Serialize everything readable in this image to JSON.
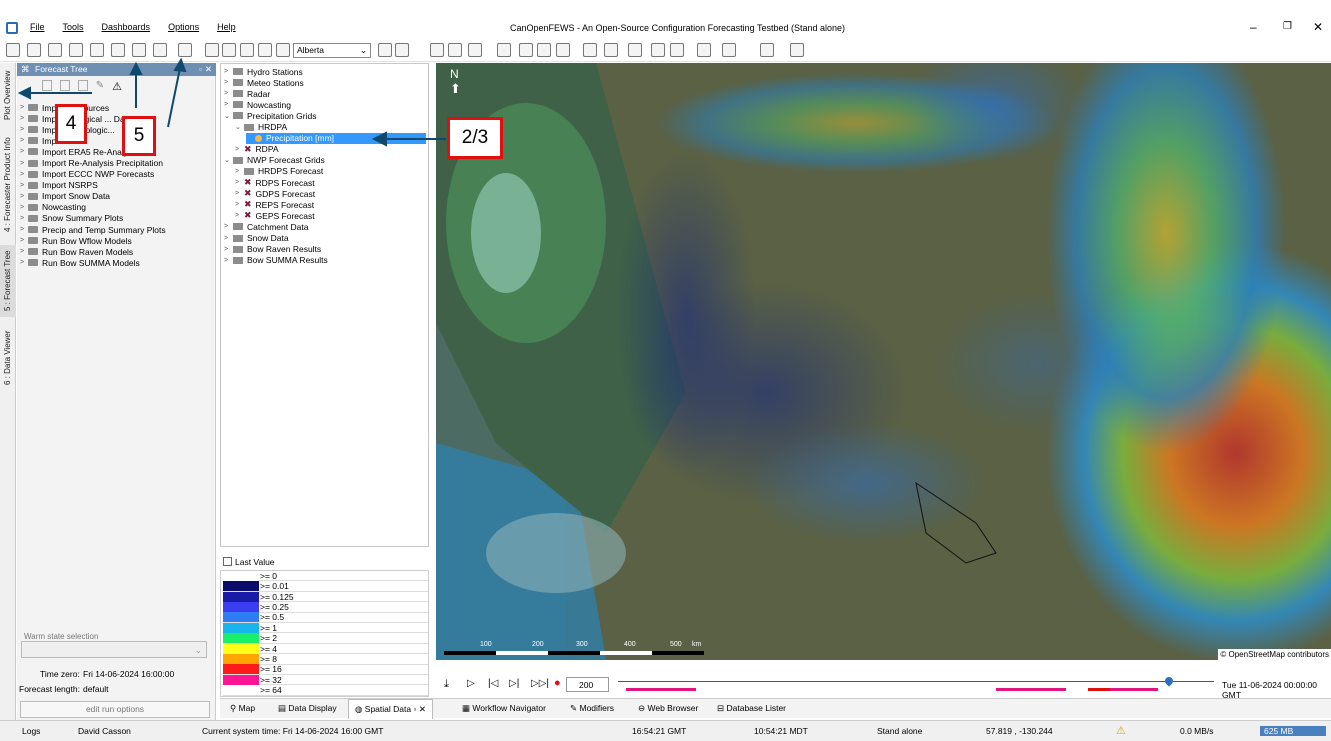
{
  "window": {
    "title": "CanOpenFEWS - An Open-Source Configuration Forecasting Testbed  (Stand alone)"
  },
  "menu": {
    "items": [
      "File",
      "Tools",
      "Dashboards",
      "Options",
      "Help"
    ]
  },
  "toolbar": {
    "region_select": "Alberta"
  },
  "side_tabs": [
    "Plot Overview",
    "4 : Forecaster Product Info",
    "5 : Forecast Tree",
    "6 : Data Viewer"
  ],
  "forecast_tree": {
    "title": "Forecast Tree",
    "items": [
      "Import ... Sources",
      "Import ... logical ... Data Mart",
      "Import ... orologic...",
      "Import ...",
      "Import ERA5 Re-Analy...",
      "Import Re-Analysis Precipitation",
      "Import ECCC NWP Forecasts",
      "Import NSRPS",
      "Import Snow Data",
      "Nowcasting",
      "Snow Summary Plots",
      "Precip and Temp Summary Plots",
      "Run Bow Wflow Models",
      "Run Bow Raven Models",
      "Run Bow SUMMA Models"
    ]
  },
  "left_bottom": {
    "warm_state_label": "Warm state selection",
    "time_zero_label": "Time zero:",
    "time_zero": "Fri 14-06-2024 16:00:00",
    "forecast_length_label": "Forecast length:",
    "forecast_length": "default",
    "edit_run_options": "edit run options"
  },
  "data_tree": {
    "items": [
      {
        "label": "Hydro Stations",
        "level": 0,
        "expanded": false
      },
      {
        "label": "Meteo Stations",
        "level": 0,
        "expanded": false
      },
      {
        "label": "Radar",
        "level": 0,
        "expanded": false
      },
      {
        "label": "Nowcasting",
        "level": 0,
        "expanded": false
      },
      {
        "label": "Precipitation Grids",
        "level": 0,
        "expanded": true
      },
      {
        "label": "HRDPA",
        "level": 1,
        "expanded": true
      },
      {
        "label": "Precipitation [mm]",
        "level": 2,
        "selected": true
      },
      {
        "label": "RDPA",
        "level": 1,
        "expanded": false,
        "marked": true
      },
      {
        "label": "NWP Forecast Grids",
        "level": 0,
        "expanded": true
      },
      {
        "label": "HRDPS Forecast",
        "level": 1,
        "expanded": false
      },
      {
        "label": "RDPS Forecast",
        "level": 1,
        "expanded": false,
        "marked": true
      },
      {
        "label": "GDPS Forecast",
        "level": 1,
        "expanded": false,
        "marked": true
      },
      {
        "label": "REPS Forecast",
        "level": 1,
        "expanded": false,
        "marked": true
      },
      {
        "label": "GEPS Forecast",
        "level": 1,
        "expanded": false,
        "marked": true
      },
      {
        "label": "Catchment Data",
        "level": 0,
        "expanded": false
      },
      {
        "label": "Snow Data",
        "level": 0,
        "expanded": false
      },
      {
        "label": "Bow Raven Results",
        "level": 0,
        "expanded": false
      },
      {
        "label": "Bow SUMMA Results",
        "level": 0,
        "expanded": false
      }
    ]
  },
  "legend": {
    "last_value_label": "Last Value",
    "entries": [
      {
        "label": ">= 0",
        "color": "#ffffff"
      },
      {
        "label": ">= 0.01",
        "color": "#0b0b6b"
      },
      {
        "label": ">= 0.125",
        "color": "#1a1aa8"
      },
      {
        "label": ">= 0.25",
        "color": "#3c3cf0"
      },
      {
        "label": ">= 0.5",
        "color": "#2e7df5"
      },
      {
        "label": ">= 1",
        "color": "#19b4ec"
      },
      {
        "label": ">= 2",
        "color": "#19f06a"
      },
      {
        "label": ">= 4",
        "color": "#ffff1a"
      },
      {
        "label": ">= 8",
        "color": "#ffa500"
      },
      {
        "label": ">= 16",
        "color": "#ff1a1a"
      },
      {
        "label": ">= 32",
        "color": "#ff1493"
      },
      {
        "label": ">= 64",
        "color": "#ffffff"
      }
    ]
  },
  "map": {
    "scale_labels": [
      "100",
      "200",
      "300",
      "400",
      "500",
      "km"
    ],
    "attribution": "© OpenStreetMap contributors"
  },
  "timebar": {
    "step": "200",
    "time": "Tue 11-06-2024 00:00:00 GMT"
  },
  "bottom_tabs": [
    "Map",
    "Data Display",
    "Spatial Data",
    "Workflow Navigator",
    "Modifiers",
    "Web Browser",
    "Database Lister"
  ],
  "status": {
    "logs": "Logs",
    "user": "David Casson",
    "system_time": "Current system time: Fri 14-06-2024 16:00 GMT",
    "gmt": "16:54:21 GMT",
    "mdt": "10:54:21 MDT",
    "mode": "Stand alone",
    "coords": "57.819 , -130.244",
    "speed": "0.0 MB/s",
    "memory": "625 MB"
  },
  "annotations": [
    "4",
    "5",
    "2/3"
  ]
}
